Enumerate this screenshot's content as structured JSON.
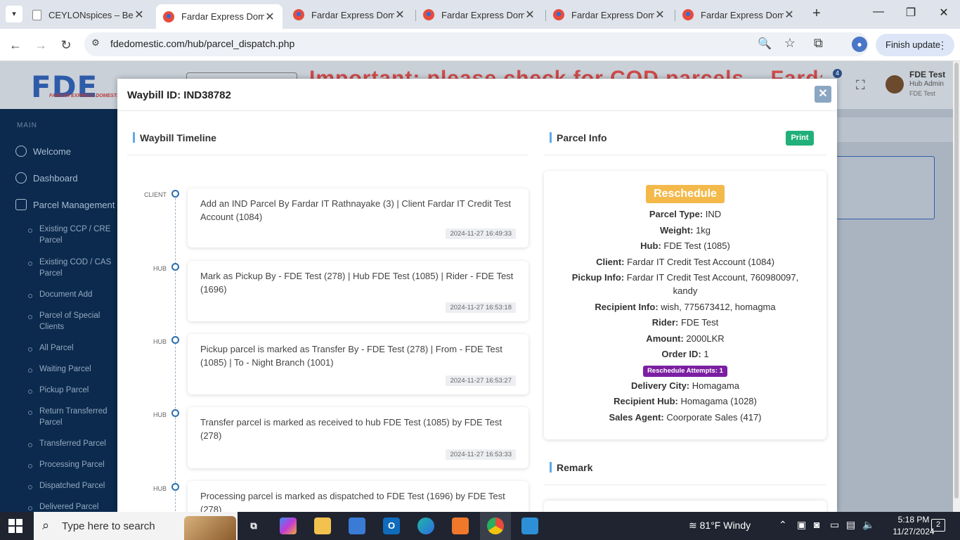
{
  "browser": {
    "tabs": [
      {
        "title": "CEYLONspices – Best",
        "icon": "document-icon"
      },
      {
        "title": "Fardar Express Dome",
        "icon": "fde-favicon"
      },
      {
        "title": "Fardar Express Dome",
        "icon": "fde-favicon"
      },
      {
        "title": "Fardar Express Dome",
        "icon": "fde-favicon"
      },
      {
        "title": "Fardar Express Dome",
        "icon": "fde-favicon"
      },
      {
        "title": "Fardar Express Dome",
        "icon": "fde-favicon"
      }
    ],
    "url": "fdedomestic.com/hub/parcel_dispatch.php",
    "finish_update": "Finish update"
  },
  "header": {
    "logo_text": "FDE",
    "logo_tagline": "FARDAR EXPRESS DOMESTIC",
    "marquee": "Important: please check for COD parcels... Fardar Express",
    "notification_count": "4",
    "user_name": "FDE Test",
    "user_role": "Hub Admin",
    "user_branch": "FDE Test"
  },
  "sidebar": {
    "section": "MAIN",
    "items": [
      {
        "label": "Welcome",
        "icon": "cloud-icon"
      },
      {
        "label": "Dashboard",
        "icon": "palette-icon"
      },
      {
        "label": "Parcel Management",
        "icon": "bag-icon"
      }
    ],
    "subitems": [
      "Existing CCP / CRE Parcel",
      "Existing COD / CAS Parcel",
      "Document Add",
      "Parcel of Special Clients",
      "All Parcel",
      "Waiting Parcel",
      "Pickup Parcel",
      "Return Transferred Parcel",
      "Transferred Parcel",
      "Processing Parcel",
      "Dispatched Parcel",
      "Delivered Parcel"
    ]
  },
  "modal": {
    "title": "Waybill ID: IND38782",
    "timeline_title": "Waybill Timeline",
    "parcel_info_title": "Parcel Info",
    "print_label": "Print",
    "remark_title": "Remark",
    "timeline": [
      {
        "role": "CLIENT",
        "text": "Add an IND Parcel By Fardar IT Rathnayake (3) | Client Fardar IT Credit Test Account (1084)",
        "time": "2024-11-27 16:49:33"
      },
      {
        "role": "HUB",
        "text": "Mark as Pickup By - FDE Test (278) | Hub FDE Test (1085) | Rider - FDE Test (1696)",
        "time": "2024-11-27 16:53:18"
      },
      {
        "role": "HUB",
        "text": "Pickup parcel is marked as Transfer By - FDE Test (278) | From - FDE Test (1085) | To - Night Branch (1001)",
        "time": "2024-11-27 16:53:27"
      },
      {
        "role": "HUB",
        "text": "Transfer parcel is marked as received to hub FDE Test (1085) by FDE Test (278)",
        "time": "2024-11-27 16:53:33"
      },
      {
        "role": "HUB",
        "text": "Processing parcel is marked as dispatched to FDE Test (1696) by FDE Test (278)",
        "time": ""
      }
    ],
    "parcel": {
      "status": "Reschedule",
      "fields": [
        {
          "label": "Parcel Type:",
          "value": "IND"
        },
        {
          "label": "Weight:",
          "value": "1kg"
        },
        {
          "label": "Hub:",
          "value": "FDE Test (1085)"
        },
        {
          "label": "Client:",
          "value": "Fardar IT Credit Test Account (1084)"
        },
        {
          "label": "Pickup Info:",
          "value": "Fardar IT Credit Test Account, 760980097, kandy"
        },
        {
          "label": "Recipient Info:",
          "value": "wish, 775673412, homagma"
        },
        {
          "label": "Rider:",
          "value": "FDE Test"
        },
        {
          "label": "Amount:",
          "value": "2000LKR"
        },
        {
          "label": "Order ID:",
          "value": "1"
        }
      ],
      "reschedule_attempts": "Reschedule Attempts: 1",
      "fields2": [
        {
          "label": "Delivery City:",
          "value": "Homagama"
        },
        {
          "label": "Recipient Hub:",
          "value": "Homagama (1028)"
        },
        {
          "label": "Sales Agent:",
          "value": "Coorporate Sales (417)"
        }
      ]
    }
  },
  "taskbar": {
    "search_placeholder": "Type here to search",
    "weather": "81°F  Windy",
    "time": "5:18 PM",
    "date": "11/27/2024",
    "notification_count": "2"
  },
  "colors": {
    "sidebar": "#0b2a4d",
    "print_button": "#21b07a",
    "reschedule_badge": "#f3b94a",
    "attempts_badge": "#7b1fa2",
    "timeline_dot": "#2a6fb0"
  }
}
